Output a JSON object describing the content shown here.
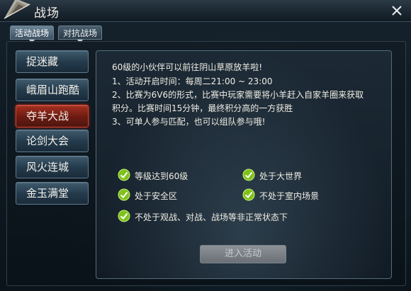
{
  "window": {
    "title": "战场",
    "close_icon": "close-icon",
    "emblem_icon": "fan-emblem-icon"
  },
  "top_tabs": [
    {
      "label": "活动战场",
      "active": true
    },
    {
      "label": "对抗战场",
      "active": false
    }
  ],
  "sidebar": {
    "items": [
      {
        "label": "捉迷藏",
        "active": false
      },
      {
        "label": "峨眉山跑酷",
        "active": false
      },
      {
        "label": "夺羊大战",
        "active": true
      },
      {
        "label": "论剑大会",
        "active": false
      },
      {
        "label": "风火连城",
        "active": false
      },
      {
        "label": "金玉满堂",
        "active": false
      }
    ]
  },
  "content": {
    "description": [
      "60级的小伙伴可以前往阴山草原放羊啦!",
      "1、活动开启时间：每周二21:00 ~ 23:00",
      "2、比赛为6V6的形式，比赛中玩家需要将小羊赶入自家羊圈来获取",
      "积分。比赛时间15分钟，最终积分高的一方获胜",
      "3、可单人参与匹配，也可以组队参与哦!"
    ],
    "requirements": [
      {
        "label": "等级达到60级",
        "met": true,
        "icon": "check-icon"
      },
      {
        "label": "处于大世界",
        "met": true,
        "icon": "check-icon"
      },
      {
        "label": "处于安全区",
        "met": true,
        "icon": "check-icon"
      },
      {
        "label": "不处于室内场景",
        "met": true,
        "icon": "check-icon"
      },
      {
        "label": "不处于观战、对战、战场等非正常状态下",
        "met": true,
        "icon": "check-icon"
      }
    ],
    "enter_button": "进入活动"
  },
  "colors": {
    "accent_active": "#a5301f",
    "check_green": "#7fc21c",
    "text": "#f0ede4"
  }
}
